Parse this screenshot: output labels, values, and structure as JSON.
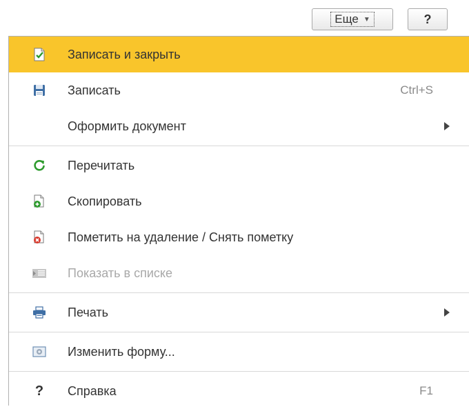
{
  "toolbar": {
    "more_label": "Еще",
    "help_label": "?"
  },
  "menu": {
    "items": [
      {
        "label": "Записать и закрыть",
        "icon": "save-and-close-icon",
        "highlighted": true
      },
      {
        "label": "Записать",
        "icon": "floppy-disk-icon",
        "shortcut": "Ctrl+S"
      },
      {
        "label": "Оформить документ",
        "submenu": true
      },
      {
        "label": "Перечитать",
        "icon": "refresh-icon"
      },
      {
        "label": "Скопировать",
        "icon": "copy-document-icon"
      },
      {
        "label": "Пометить на удаление / Снять пометку",
        "icon": "mark-delete-icon"
      },
      {
        "label": "Показать в списке",
        "icon": "show-in-list-icon",
        "disabled": true
      },
      {
        "label": "Печать",
        "icon": "printer-icon",
        "submenu": true
      },
      {
        "label": "Изменить форму...",
        "icon": "change-form-icon"
      },
      {
        "label": "Справка",
        "icon": "help-icon",
        "icon_glyph": "?",
        "shortcut": "F1"
      }
    ]
  },
  "colors": {
    "highlight": "#f9c52b",
    "text": "#333333",
    "disabled_text": "#a8a8a8",
    "shortcut_text": "#8a8a8a"
  }
}
